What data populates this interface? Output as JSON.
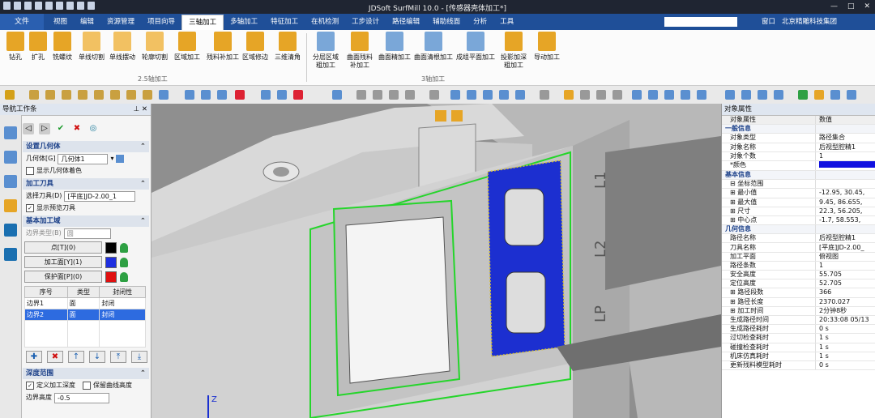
{
  "window": {
    "title": "JDSoft SurfMill 10.0 - [传感器壳体加工*]",
    "controls": [
      "—",
      "□",
      "✕"
    ]
  },
  "menu": {
    "file": "文件",
    "tabs": [
      "视图",
      "编辑",
      "资源管理",
      "项目向导",
      "三轴加工",
      "多轴加工",
      "特征加工",
      "在机检测",
      "工步设计",
      "路径编辑",
      "辅助线面",
      "分析",
      "工具"
    ],
    "active_tab": "三轴加工",
    "window_menu": "窗口",
    "company": "北京精雕科技集团"
  },
  "ribbon": {
    "group_25": {
      "label": "2.5轴加工",
      "buttons": [
        "钻孔",
        "扩孔",
        "铣螺纹",
        "单线切割",
        "单线摆动",
        "轮廓切割",
        "区域加工",
        "残料补加工",
        "区域修边",
        "三维清角"
      ]
    },
    "group_3": {
      "label": "3轴加工",
      "buttons": [
        {
          "line1": "分层区域",
          "line2": "粗加工"
        },
        {
          "line1": "曲面残料",
          "line2": "补加工"
        },
        {
          "line1": "曲面精加工",
          "line2": ""
        },
        {
          "line1": "曲面清根加工",
          "line2": ""
        },
        {
          "line1": "成组平面加工",
          "line2": ""
        },
        {
          "line1": "投影加深",
          "line2": "粗加工"
        },
        {
          "line1": "导动加工",
          "line2": ""
        }
      ]
    }
  },
  "nav_panel": {
    "title": "导航工作条",
    "sections": {
      "geometry": {
        "header": "设置几何体",
        "label": "几何体[G]",
        "value": "几何体1",
        "checkbox_label": "显示几何体着色"
      },
      "tool": {
        "header": "加工刀具",
        "label": "选择刀具(D)",
        "value": "[平底]JD-2.00_1",
        "checkbox_label": "显示预览刀具"
      },
      "domain": {
        "header": "基本加工域",
        "boundary_type_label": "边界类型(B)",
        "boundary_type_value": "圆",
        "buttons": [
          {
            "label": "点[T](0)",
            "color": "#000000"
          },
          {
            "label": "加工面[Y](1)",
            "color": "#1f2fe0"
          },
          {
            "label": "保护面[P](0)",
            "color": "#e01010"
          }
        ],
        "table": {
          "headers": [
            "序号",
            "类型",
            "封闭性"
          ],
          "rows": [
            [
              "边界1",
              "面",
              "封闭"
            ],
            [
              "边界2",
              "面",
              "封闭"
            ]
          ],
          "selected_row": 1
        }
      },
      "depth": {
        "header": "深度范围",
        "cb1": "定义加工深度",
        "cb2": "保留曲线高度",
        "label": "边界高度",
        "value": "-0.5"
      }
    }
  },
  "viewport": {
    "labels": [
      "L1",
      "L2",
      "LP"
    ],
    "axis_label": "Z"
  },
  "prop_panel": {
    "title": "对象属性",
    "header": [
      "对象属性",
      "数值"
    ],
    "rows": [
      {
        "k": "一般信息",
        "v": "",
        "group": true
      },
      {
        "k": "对象类型",
        "v": "路径集合"
      },
      {
        "k": "对象名称",
        "v": "后视型腔精1"
      },
      {
        "k": "对象个数",
        "v": "1"
      },
      {
        "k": "*颜色",
        "v": "",
        "swatch": "#1010e0"
      },
      {
        "k": "基本信息",
        "v": "",
        "group": true
      },
      {
        "k": "⊟ 坐标范围",
        "v": ""
      },
      {
        "k": "    ⊞ 最小值",
        "v": "-12.95, 30.45,"
      },
      {
        "k": "    ⊞ 最大值",
        "v": "9.45, 86.655,"
      },
      {
        "k": "⊞ 尺寸",
        "v": "22.3, 56.205,"
      },
      {
        "k": "⊞ 中心点",
        "v": "-1.7, 58.553,"
      },
      {
        "k": "几何信息",
        "v": "",
        "group": true
      },
      {
        "k": "路径名称",
        "v": "后视型腔精1"
      },
      {
        "k": "刀具名称",
        "v": "[平底]JD-2.00_"
      },
      {
        "k": "加工平面",
        "v": "俯视图"
      },
      {
        "k": "路径条数",
        "v": "1"
      },
      {
        "k": "安全高度",
        "v": "55.705"
      },
      {
        "k": "定位高度",
        "v": "52.705"
      },
      {
        "k": "⊞ 路径段数",
        "v": "366"
      },
      {
        "k": "⊞ 路径长度",
        "v": "2370.027"
      },
      {
        "k": "⊞ 加工时间",
        "v": "2分钟8秒"
      },
      {
        "k": "生成路径时间",
        "v": "20:33:08 05/13"
      },
      {
        "k": "生成路径耗时",
        "v": "0 s"
      },
      {
        "k": "过切检查耗时",
        "v": "1 s"
      },
      {
        "k": "碰撞检查耗时",
        "v": "1 s"
      },
      {
        "k": "机床仿真耗时",
        "v": "1 s"
      },
      {
        "k": "更新残料模型耗时",
        "v": "0 s"
      }
    ]
  }
}
